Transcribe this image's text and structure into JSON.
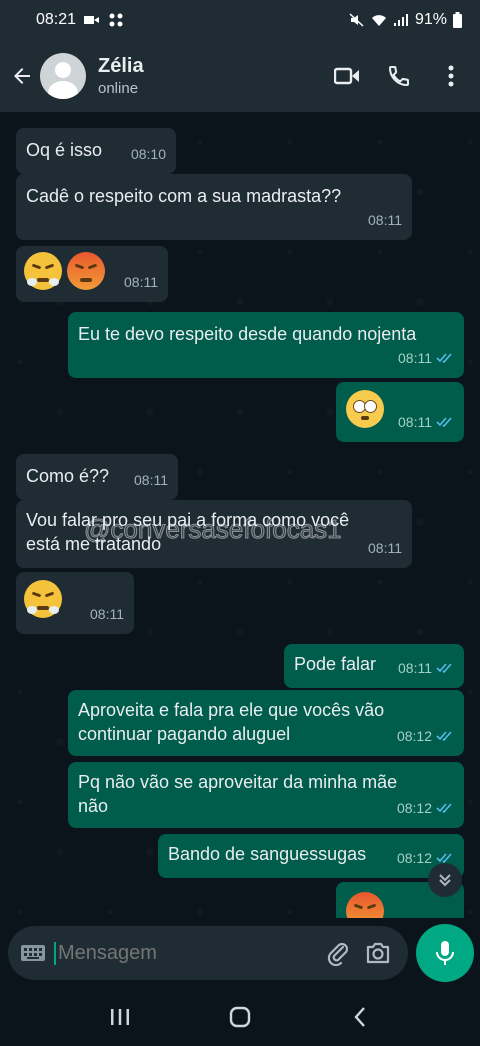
{
  "status_bar": {
    "time": "08:21",
    "battery": "91%"
  },
  "header": {
    "contact_name": "Zélia",
    "contact_status": "online"
  },
  "messages": [
    {
      "dir": "in",
      "text": "Oq é isso",
      "time": "08:10"
    },
    {
      "dir": "in",
      "text": "Cadê o respeito com a sua madrasta??",
      "time": "08:11"
    },
    {
      "dir": "in",
      "emoji": [
        "face-with-steam-icon",
        "angry-face-icon"
      ],
      "time": "08:11"
    },
    {
      "dir": "out",
      "text": "Eu te devo respeito desde quando nojenta",
      "time": "08:11"
    },
    {
      "dir": "out",
      "emoji": [
        "eye-roll-face-icon"
      ],
      "time": "08:11"
    },
    {
      "dir": "in",
      "text": "Como é??",
      "time": "08:11"
    },
    {
      "dir": "in",
      "text_line1": "Vou falar pro seu pai a forma como você",
      "text_line2": "está me tratando",
      "time": "08:11"
    },
    {
      "dir": "in",
      "emoji": [
        "face-with-steam-icon"
      ],
      "time": "08:11"
    },
    {
      "dir": "out",
      "text": "Pode falar",
      "time": "08:11"
    },
    {
      "dir": "out",
      "text_line1": "Aproveita e fala pra ele que vocês vão",
      "text_line2": "continuar pagando aluguel",
      "time": "08:12"
    },
    {
      "dir": "out",
      "text_line1": "Pq não vão se aproveitar da minha mãe",
      "text_line2": "não",
      "time": "08:12"
    },
    {
      "dir": "out",
      "text": "Bando de sanguessugas",
      "time": "08:12"
    }
  ],
  "watermark": "@conversasefofocas1",
  "input": {
    "placeholder": "Mensagem"
  },
  "colors": {
    "incoming": "#1f2c34",
    "outgoing": "#005c4b",
    "accent": "#00a884",
    "background": "#0b141a",
    "read_ticks": "#53bdeb"
  }
}
